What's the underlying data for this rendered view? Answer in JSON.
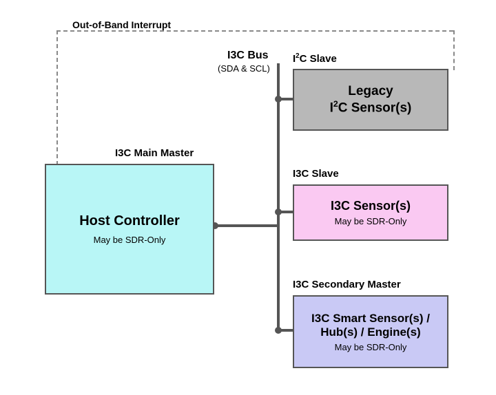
{
  "labels": {
    "oob": "Out-of-Band Interrupt",
    "busTitle": "I3C Bus",
    "busSub": "(SDA & SCL)",
    "mainMaster": "I3C Main Master",
    "i2cSlave": "I²C Slave",
    "i3cSlave": "I3C Slave",
    "secondaryMaster": "I3C Secondary Master"
  },
  "nodes": {
    "host": {
      "title": "Host Controller",
      "sub": "May be SDR-Only",
      "color": "#b8f6f6"
    },
    "legacy": {
      "titleLine1": "Legacy",
      "titleLine2": "I²C Sensor(s)",
      "color": "#b8b8b8"
    },
    "i3cSensor": {
      "title": "I3C Sensor(s)",
      "sub": "May be SDR-Only",
      "color": "#fac9f2"
    },
    "smart": {
      "titleLine1": "I3C Smart Sensor(s) /",
      "titleLine2": "Hub(s) / Engine(s)",
      "sub": "May be SDR-Only",
      "color": "#c9c9f5"
    }
  },
  "connections": {
    "bus": "I3C bus backbone connecting host to all three slave/secondary devices via SDA & SCL",
    "oobInterrupt": "Dashed out-of-band interrupt line from Legacy I²C Sensor back to Host Controller"
  }
}
